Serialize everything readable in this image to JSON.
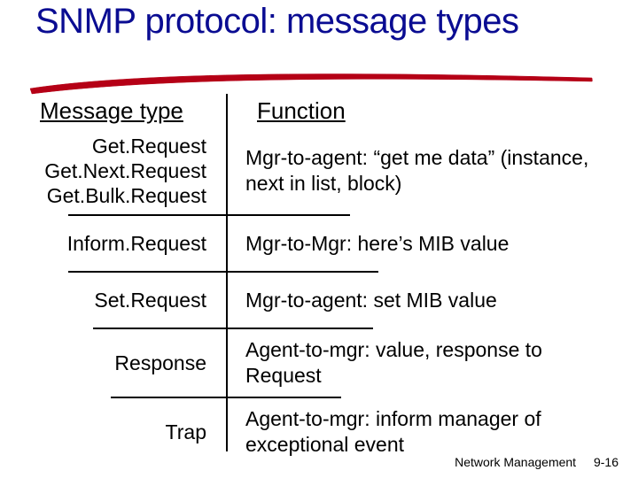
{
  "title": "SNMP protocol: message types",
  "headers": {
    "left": "Message type",
    "right": "Function"
  },
  "rows": [
    {
      "type": "GetRequest\nGetNextRequest\nGetBulkRequest",
      "type_html": "Get.Request<br>Get.Next.Request<br>Get.Bulk.Request",
      "func": "Mgr-to-agent: “get me data” (instance, next in list, block)",
      "hr_left_w": 178,
      "hr_right_w": 140
    },
    {
      "type": "InformRequest",
      "type_html": "Inform.Request",
      "func": "Mgr-to-Mgr: here’s MIB value",
      "hr_left_w": 178,
      "hr_right_w": 172
    },
    {
      "type": "SetRequest",
      "type_html": "Set.Request",
      "func": "Mgr-to-agent: set MIB value",
      "hr_left_w": 150,
      "hr_right_w": 166
    },
    {
      "type": "Response",
      "type_html": "Response",
      "func": "Agent-to-mgr: value, response to Request",
      "hr_left_w": 130,
      "hr_right_w": 130
    },
    {
      "type": "Trap",
      "type_html": "Trap",
      "func": "Agent-to-mgr: inform manager of exceptional event",
      "hr_left_w": 0,
      "hr_right_w": 0
    }
  ],
  "footer": {
    "chapter": "Network Management",
    "page": "9-16"
  }
}
